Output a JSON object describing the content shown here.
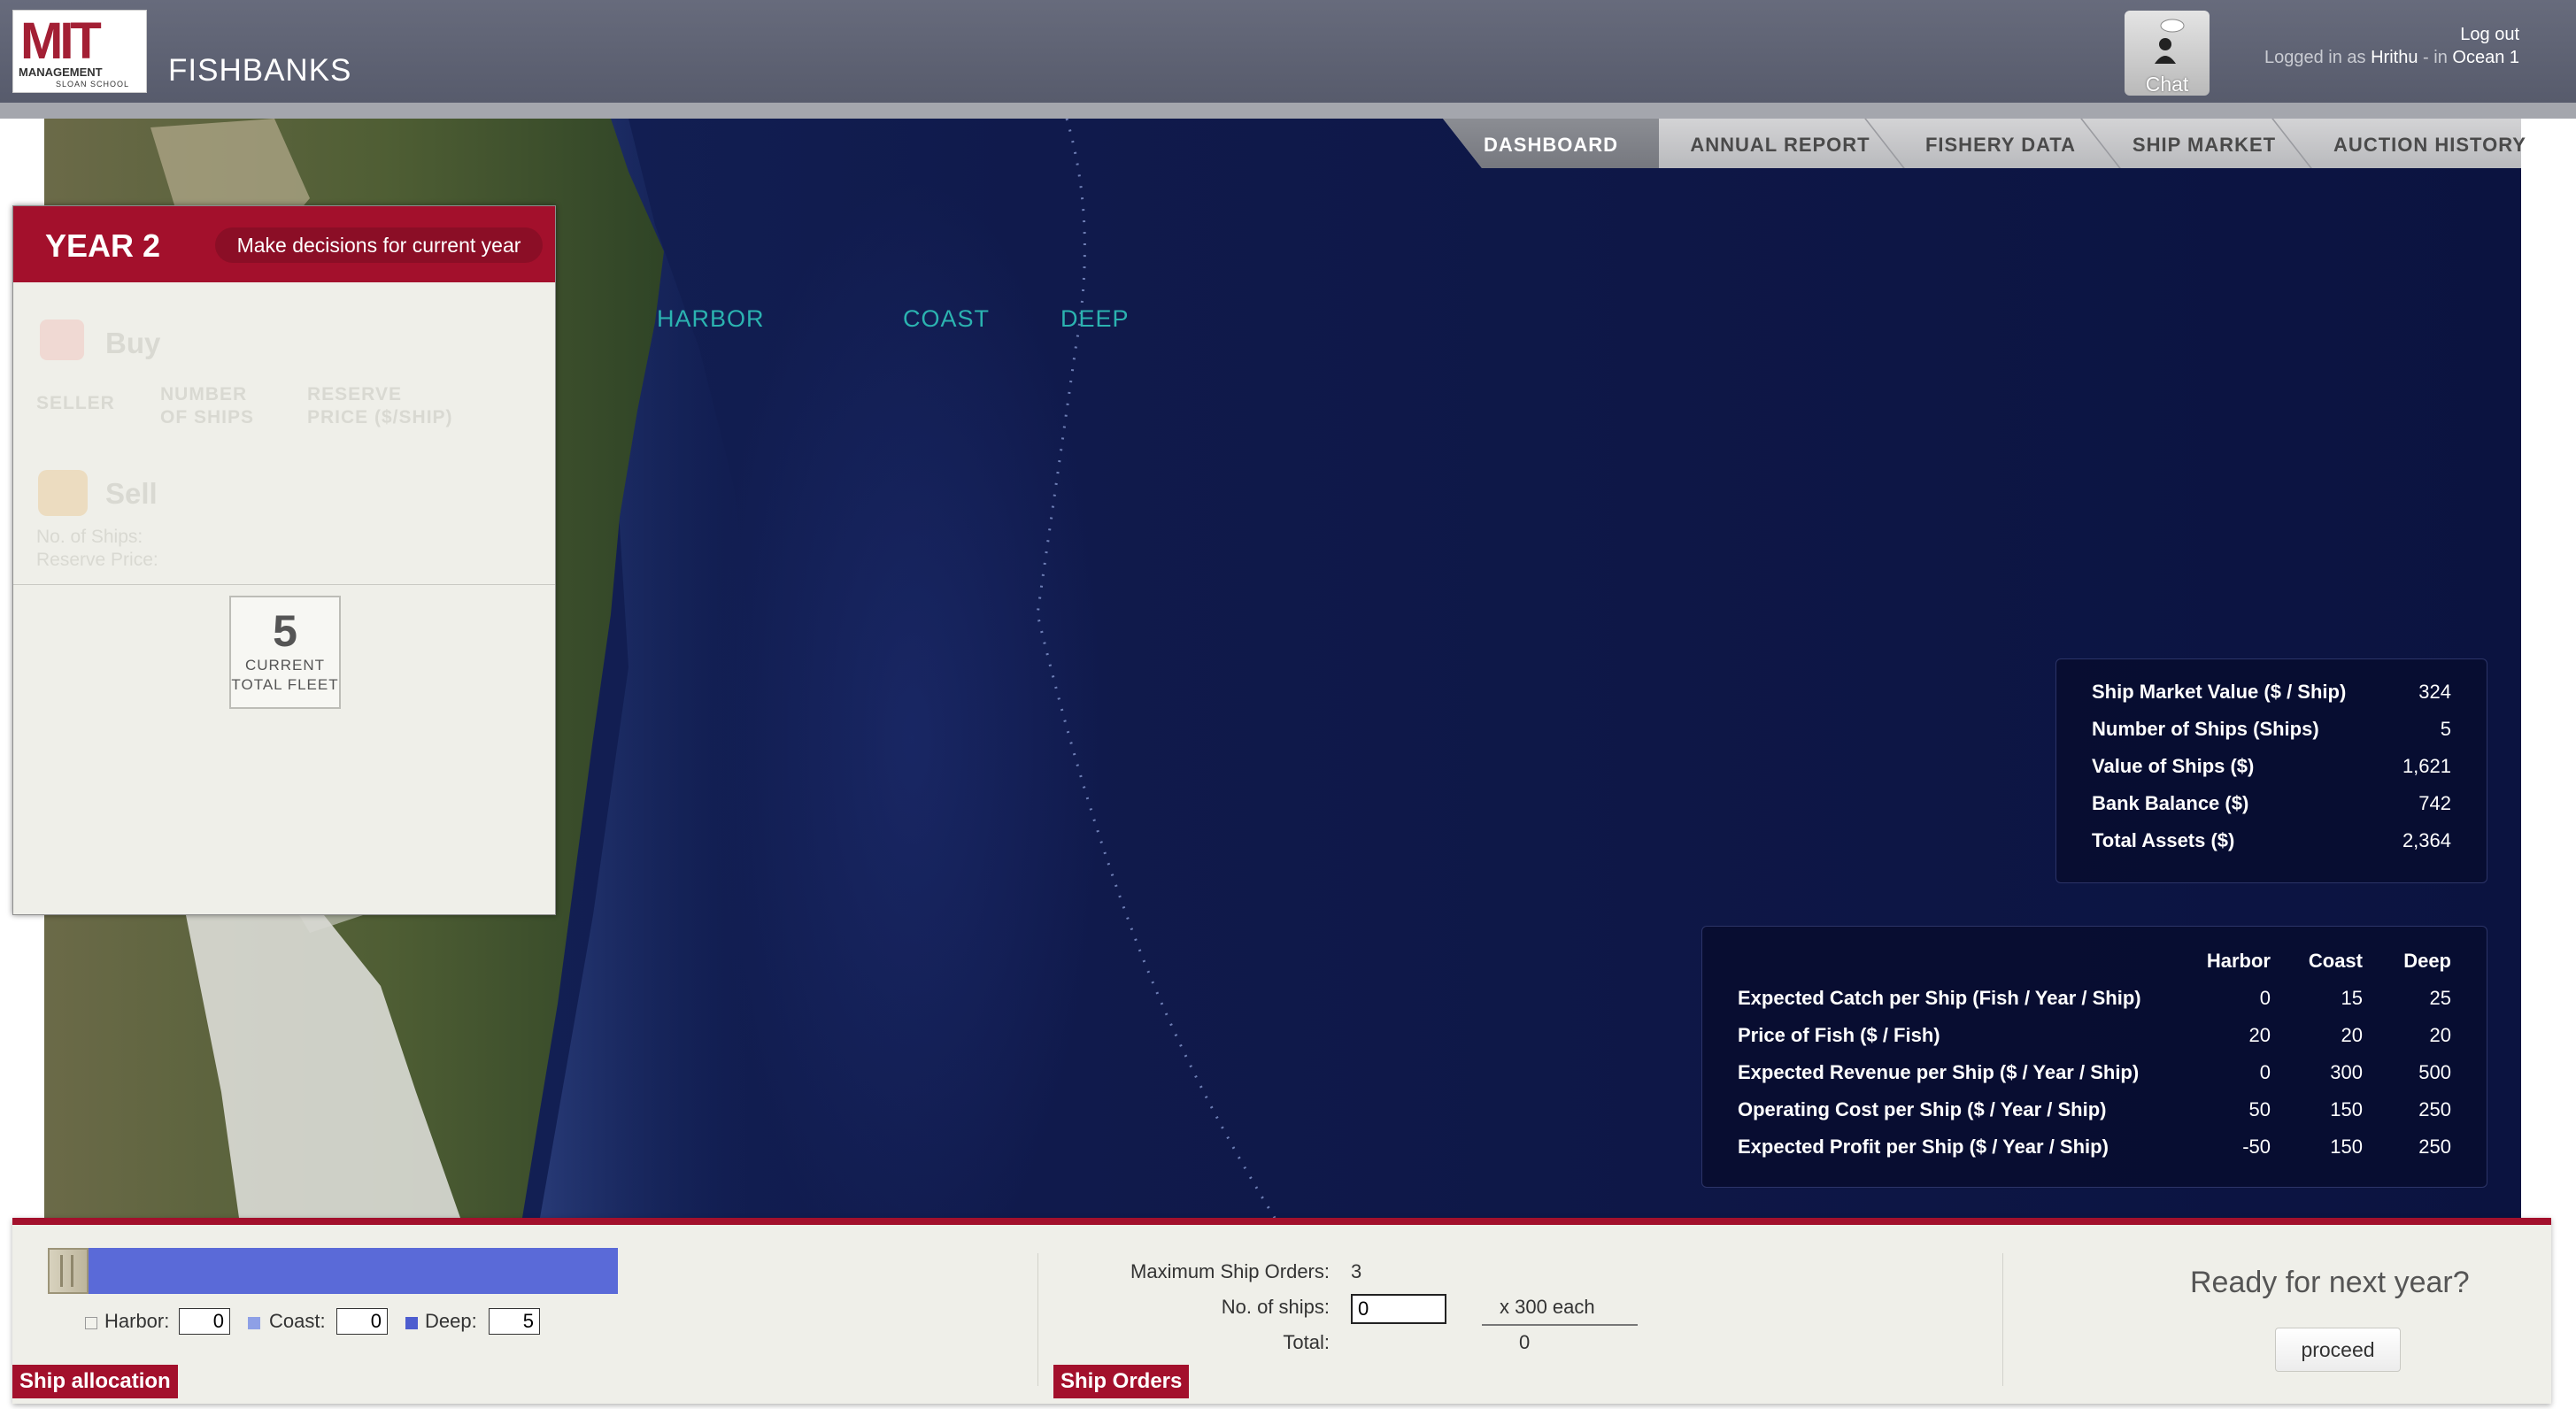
{
  "header": {
    "logo_mit": "MIT",
    "logo_management": "MANAGEMENT",
    "logo_sloan": "SLOAN SCHOOL",
    "app_title": "FISHBANKS",
    "chat_label": "Chat",
    "logout_label": "Log out",
    "logged_in_prefix": "Logged in as",
    "user_name": "Hrithu",
    "sep": "- in",
    "ocean": "Ocean 1"
  },
  "tabs": [
    {
      "label": "DASHBOARD",
      "active": true
    },
    {
      "label": "ANNUAL REPORT",
      "active": false
    },
    {
      "label": "FISHERY DATA",
      "active": false
    },
    {
      "label": "SHIP MARKET",
      "active": false
    },
    {
      "label": "AUCTION HISTORY",
      "active": false
    }
  ],
  "map": {
    "zones": [
      "HARBOR",
      "COAST",
      "DEEP"
    ]
  },
  "year_panel": {
    "title": "YEAR 2",
    "decisions_button": "Make decisions for current year",
    "buy_label": "Buy",
    "col_seller": "SELLER",
    "col_number_1": "NUMBER",
    "col_number_2": "OF SHIPS",
    "col_reserve_1": "RESERVE",
    "col_reserve_2": "PRICE ($/SHIP)",
    "sell_label": "Sell",
    "sell_ships": "No. of Ships:",
    "sell_price": "Reserve Price:",
    "fleet_value": "5",
    "fleet_caption_1": "CURRENT",
    "fleet_caption_2": "TOTAL FLEET"
  },
  "summary": [
    {
      "label": "Ship Market Value ($ / Ship)",
      "value": "324"
    },
    {
      "label": "Number of Ships (Ships)",
      "value": "5"
    },
    {
      "label": "Value of Ships ($)",
      "value": "1,621"
    },
    {
      "label": "Bank Balance ($)",
      "value": "742"
    },
    {
      "label": "Total Assets ($)",
      "value": "2,364"
    }
  ],
  "forecast": {
    "columns": [
      "Harbor",
      "Coast",
      "Deep"
    ],
    "rows": [
      {
        "label": "Expected Catch per Ship (Fish / Year / Ship)",
        "values": [
          "0",
          "15",
          "25"
        ]
      },
      {
        "label": "Price of Fish ($ / Fish)",
        "values": [
          "20",
          "20",
          "20"
        ]
      },
      {
        "label": "Expected Revenue per Ship ($ / Year / Ship)",
        "values": [
          "0",
          "300",
          "500"
        ]
      },
      {
        "label": "Operating Cost per Ship ($ / Year / Ship)",
        "values": [
          "50",
          "150",
          "250"
        ]
      },
      {
        "label": "Expected Profit per Ship ($ / Year / Ship)",
        "values": [
          "-50",
          "150",
          "250"
        ]
      }
    ]
  },
  "allocation": {
    "tag": "Ship allocation",
    "harbor_label": "Harbor:",
    "harbor_value": "0",
    "coast_label": "Coast:",
    "coast_value": "0",
    "deep_label": "Deep:",
    "deep_value": "5",
    "colors": {
      "harbor": "#f2f2ec",
      "coast": "#8ea0e6",
      "deep": "#5a6ad8"
    }
  },
  "orders": {
    "tag": "Ship Orders",
    "max_label": "Maximum Ship Orders:",
    "max_value": "3",
    "ships_label": "No. of ships:",
    "ships_value": "0",
    "each_label": "x 300 each",
    "total_label": "Total:",
    "total_value": "0"
  },
  "next_year": {
    "prompt": "Ready for next year?",
    "button": "proceed"
  }
}
